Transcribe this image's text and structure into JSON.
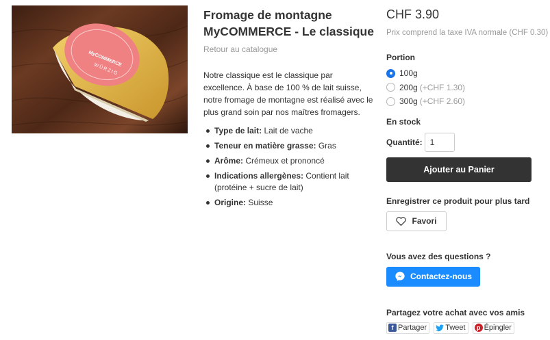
{
  "product": {
    "title": "Fromage de montagne MyCOMMERCE - Le classique",
    "back_link": "Retour au catalogue",
    "description": "Notre classique est le classique par excellence. À base de 100 % de lait suisse, notre fromage de montagne est réalisé avec le plus grand soin par nos maîtres fromagers.",
    "image_label": {
      "brand": "MyCOMMERCE",
      "flavor": "WÜRZIG"
    },
    "features": [
      {
        "label": "Type de lait:",
        "value": " Lait de vache"
      },
      {
        "label": "Teneur en matière grasse:",
        "value": " Gras"
      },
      {
        "label": "Arôme:",
        "value": " Crémeux et prononcé"
      },
      {
        "label": "Indications allergènes:",
        "value": " Contient lait (protéine + sucre de lait)"
      },
      {
        "label": "Origine:",
        "value": " Suisse"
      }
    ]
  },
  "buybox": {
    "price": "CHF 3.90",
    "tax_note": "Prix comprend la taxe IVA normale (CHF 0.30)",
    "portion_label": "Portion",
    "options": [
      {
        "label": "100g",
        "extra": "",
        "selected": true
      },
      {
        "label": "200g",
        "extra": "(+CHF 1.30)",
        "selected": false
      },
      {
        "label": "300g",
        "extra": "(+CHF 2.60)",
        "selected": false
      }
    ],
    "stock": "En stock",
    "quantity_label": "Quantité:",
    "quantity_value": "1",
    "add_to_cart": "Ajouter au Panier",
    "save_label": "Enregistrer ce produit pour plus tard",
    "favorite": "Favori",
    "questions_label": "Vous avez des questions ?",
    "contact": "Contactez-nous",
    "share_label": "Partagez votre achat avec vos amis",
    "share": {
      "facebook": "Partager",
      "twitter": "Tweet",
      "pinterest": "Épingler"
    }
  },
  "icons": {
    "selected_radio": "radio-checked-icon",
    "favorite": "heart-icon",
    "contact": "messenger-icon",
    "facebook": "facebook-icon",
    "twitter": "twitter-icon",
    "pinterest": "pinterest-icon"
  },
  "colors": {
    "accent": "#1a73e8",
    "contact_button": "#1a8cff",
    "cart_button": "#333333",
    "facebook": "#3b5998",
    "twitter": "#1da1f2",
    "pinterest": "#cb2027",
    "label_band": "#e8767a"
  }
}
